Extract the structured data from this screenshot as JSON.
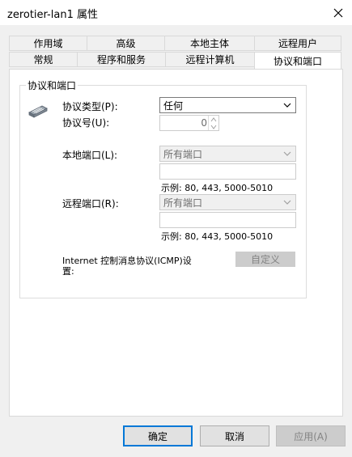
{
  "window": {
    "title": "zerotier-lan1 属性"
  },
  "tabs": {
    "row_top": [
      "作用域",
      "高级",
      "本地主体",
      "远程用户"
    ],
    "row_bottom": [
      "常规",
      "程序和服务",
      "远程计算机",
      "协议和端口"
    ],
    "active": "协议和端口"
  },
  "group": {
    "title": "协议和端口",
    "protocol_type_label": "协议类型(P):",
    "protocol_type_value": "任何",
    "protocol_number_label": "协议号(U):",
    "protocol_number_value": "0",
    "local_port_label": "本地端口(L):",
    "local_port_value": "所有端口",
    "local_example": "示例: 80, 443, 5000-5010",
    "remote_port_label": "远程端口(R):",
    "remote_port_value": "所有端口",
    "remote_example": "示例: 80, 443, 5000-5010",
    "icmp_label_line1": "Internet 控制消息协议(ICMP)设",
    "icmp_label_line2": "置:",
    "customize_button": "自定义"
  },
  "buttons": {
    "ok": "确定",
    "cancel": "取消",
    "apply": "应用(A)"
  }
}
